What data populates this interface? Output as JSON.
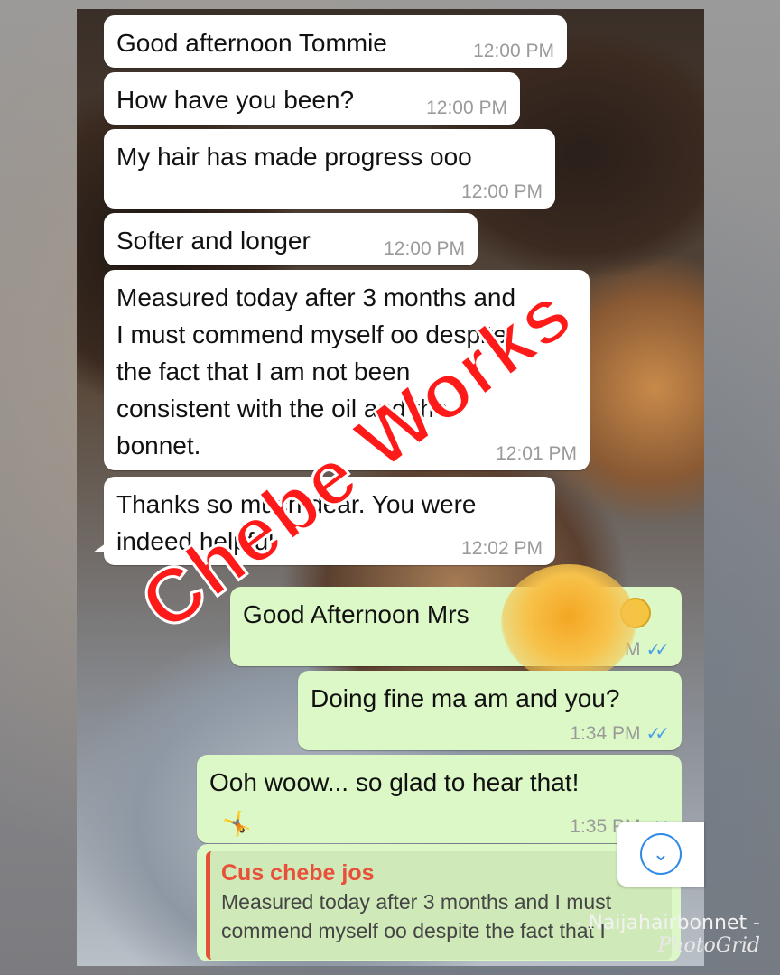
{
  "messages_in": [
    {
      "text": "Good afternoon Tommie",
      "time": "12:00 PM"
    },
    {
      "text": "How have you been?",
      "time": "12:00 PM"
    },
    {
      "text": "My hair has made progress ooo",
      "time": "12:00 PM"
    },
    {
      "text": "Softer and longer",
      "time": "12:00 PM"
    },
    {
      "lines": [
        "Measured today after 3 months and",
        "I must commend myself oo despite",
        "the fact that I am not been",
        "consistent with the oil and the",
        "bonnet."
      ],
      "time": "12:01 PM"
    },
    {
      "lines": [
        "Thanks so much dear. You were",
        "indeed helpful."
      ],
      "time": "12:02 PM"
    }
  ],
  "messages_out": [
    {
      "text": "Good Afternoon Mrs",
      "time": "M"
    },
    {
      "text": "Doing fine ma am and you?",
      "time": "1:34 PM"
    },
    {
      "text": "Ooh woow... so glad to hear that!",
      "time": "1:35 PM"
    }
  ],
  "reply_quote": {
    "author": "Cus chebe jos",
    "lines": [
      "Measured today after 3 months and I must",
      "commend myself oo despite the fact that I"
    ]
  },
  "overlay": {
    "watermark": "Chebe Works",
    "signature": "- Naijahairbonnet -",
    "brand": "PhotoGrid"
  },
  "colors": {
    "incoming_bubble": "#ffffff",
    "outgoing_bubble": "#dcf8c6",
    "read_ticks": "#4a9ee8",
    "watermark": "#ff1a1a"
  }
}
